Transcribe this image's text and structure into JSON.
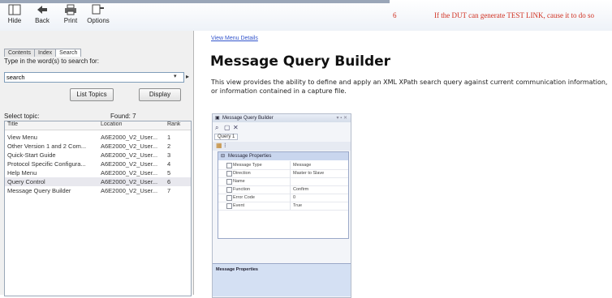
{
  "toolbar": {
    "buttons": [
      {
        "label": "Hide"
      },
      {
        "label": "Back"
      },
      {
        "label": "Print"
      },
      {
        "label": "Options"
      }
    ]
  },
  "background_row": {
    "number": "6",
    "text": "If the DUT can generate TEST LINK, cause it to do so"
  },
  "left": {
    "tabs": [
      "Contents",
      "Index",
      "Search"
    ],
    "search_prompt": "Type in the word(s) to search for:",
    "search_value": "search",
    "list_topics_label": "List Topics",
    "display_label": "Display",
    "select_topic_label": "Select topic:",
    "found_label": "Found: 7",
    "columns": [
      "Title",
      "Location",
      "Rank"
    ],
    "rows": [
      {
        "title": "View Menu",
        "location": "A6E2000_V2_User...",
        "rank": "1"
      },
      {
        "title": "Other Version 1 and 2 Com...",
        "location": "A6E2000_V2_User...",
        "rank": "2"
      },
      {
        "title": "Quick-Start Guide",
        "location": "A6E2000_V2_User...",
        "rank": "3"
      },
      {
        "title": "Protocol Specific Configura...",
        "location": "A6E2000_V2_User...",
        "rank": "4"
      },
      {
        "title": "Help Menu",
        "location": "A6E2000_V2_User...",
        "rank": "5"
      },
      {
        "title": "Query Control",
        "location": "A6E2000_V2_User...",
        "rank": "6"
      },
      {
        "title": "Message Query Builder",
        "location": "A6E2000_V2_User...",
        "rank": "7"
      }
    ],
    "selected_index": 5
  },
  "right": {
    "breadcrumb": "View Menu Details",
    "title": "Message Query Builder",
    "description": "This view provides the ability to define and apply an XML XPath search query against current communication information, or information contained in a capture file.",
    "shot": {
      "window_title": "Message Query Builder",
      "tab": "Query 1",
      "grid_header": "Message Properties",
      "grid_rows": [
        {
          "name": "Message Type",
          "value": "Message"
        },
        {
          "name": "Direction",
          "value": "Master to Slave"
        },
        {
          "name": "Name",
          "value": ""
        },
        {
          "name": "Function",
          "value": "Confirm"
        },
        {
          "name": "Error Code",
          "value": "0"
        },
        {
          "name": "Event",
          "value": "True"
        }
      ],
      "props_label": "Message Properties"
    }
  },
  "colors": {
    "link": "#3355cc",
    "red_text": "#d03020",
    "grid_header": "#c9d6ee"
  }
}
